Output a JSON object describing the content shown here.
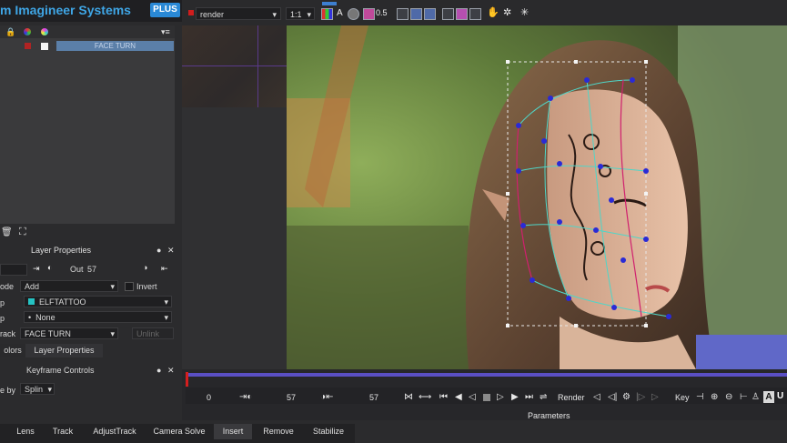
{
  "header": {
    "brand": "m Imagineer Systems",
    "badge": "PLUS"
  },
  "toolbar": {
    "render_select": "render",
    "zoom": "1:1",
    "channel_a": "A",
    "opacity": "0.5"
  },
  "layers": {
    "row_label": "FACE TURN"
  },
  "layer_properties": {
    "title": "Layer Properties",
    "out_label": "Out",
    "out_value": "57",
    "mode_label": "ode",
    "mode_value": "Add",
    "invert_label": "Invert",
    "matte_label": "p",
    "matte_value": "ELFTATTOO",
    "matte2_label": "p",
    "matte2_value": "None",
    "track_label": "rack",
    "track_value": "FACE TURN",
    "track_btn": "Unlink"
  },
  "tabs": {
    "colors": "olors",
    "layer_properties": "Layer Properties"
  },
  "keyframe": {
    "title": "Keyframe Controls",
    "by_label": "e by",
    "interp": "Splin"
  },
  "timeline": {
    "frame_start": "0",
    "frame_in": "57",
    "frame_out": "57",
    "render_label": "Render",
    "key_label": "Key",
    "params_label": "Parameters",
    "overlay_letter": "A",
    "end_char": "U"
  },
  "bottom_tabs": [
    "Lens",
    "Track",
    "AdjustTrack",
    "Camera Solve",
    "Insert",
    "Remove",
    "Stabilize"
  ],
  "colors": {
    "accent": "#3fa6e6",
    "badge": "#2a89d6",
    "layer_select": "#5b7fa8",
    "timeline_bar": "#5a4fc4",
    "playhead": "#d41e1e",
    "spline_magenta": "#d0206e",
    "spline_cyan": "#4fd6c8",
    "spline_point": "#2a2ad6"
  }
}
